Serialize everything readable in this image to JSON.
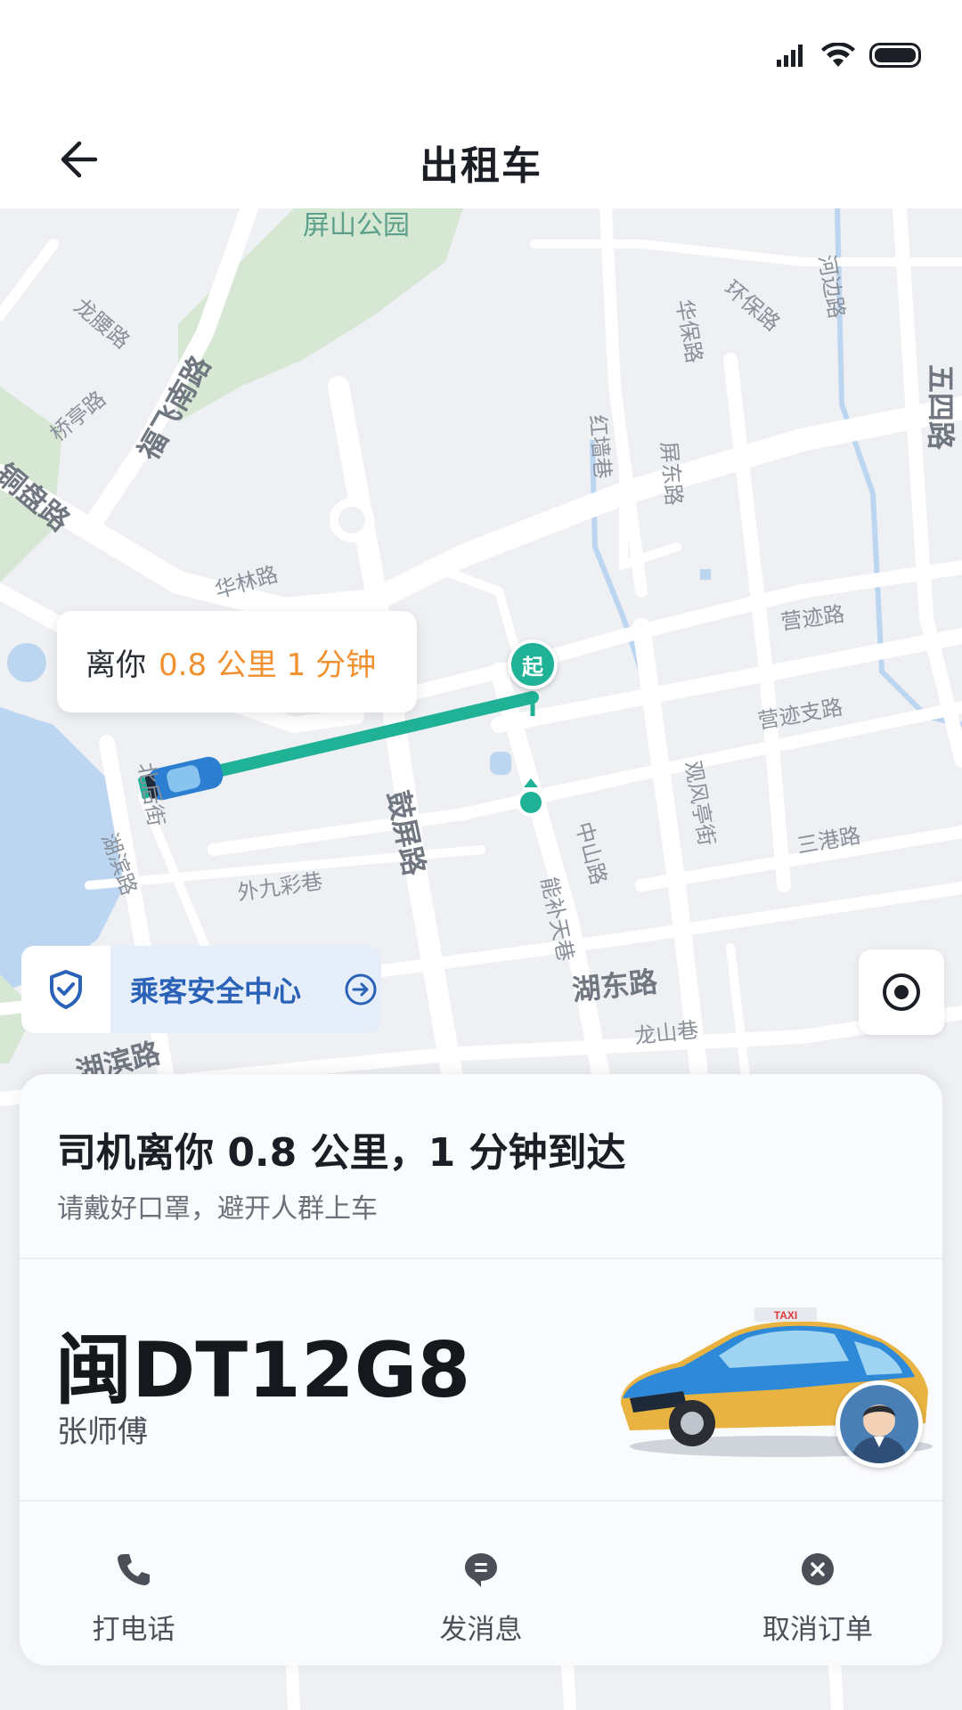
{
  "header": {
    "title": "出租车"
  },
  "map": {
    "labels": {
      "park": "屏山公园",
      "longyao": "龙腰路",
      "qiaoting": "桥亭路",
      "tongpan": "铜盘路",
      "fufeinan": "福飞南路",
      "hualin": "华林路",
      "huabao": "华保路",
      "huanbao": "环保路",
      "hebian": "河边路",
      "wusi": "五四路",
      "hongqiang": "红墙巷",
      "pingdong": "屏东路",
      "yingji": "营迹路",
      "yingjizhi": "营迹支路",
      "beihou": "北后街",
      "gupingroad": "鼓屏路",
      "zhongshan": "中山路",
      "nengbutian": "能补天巷",
      "guanfengting": "观风亭街",
      "sangang": "三港路",
      "hubin": "湖滨路",
      "waijiucai": "外九彩巷",
      "hudong": "湖东路",
      "longshan": "龙山巷",
      "hubinroad": "湖滨路"
    },
    "distance_tip": {
      "prefix": "离你",
      "value": "0.8 公里 1 分钟"
    },
    "start_marker": "起",
    "safety_center": "乘客安全中心"
  },
  "card": {
    "eta": "司机离你 0.8 公里，1 分钟到达",
    "hint": "请戴好口罩，避开人群上车",
    "plate": "闽DT12G8",
    "driver": "张师傅",
    "taxi_sign": "TAXI",
    "actions": [
      {
        "label": "打电话",
        "icon": "phone-icon"
      },
      {
        "label": "发消息",
        "icon": "message-icon"
      },
      {
        "label": "取消订单",
        "icon": "cancel-icon"
      }
    ]
  },
  "colors": {
    "route": "#1fb296",
    "accent_orange": "#f0902e",
    "safety_blue": "#2a62b8"
  }
}
